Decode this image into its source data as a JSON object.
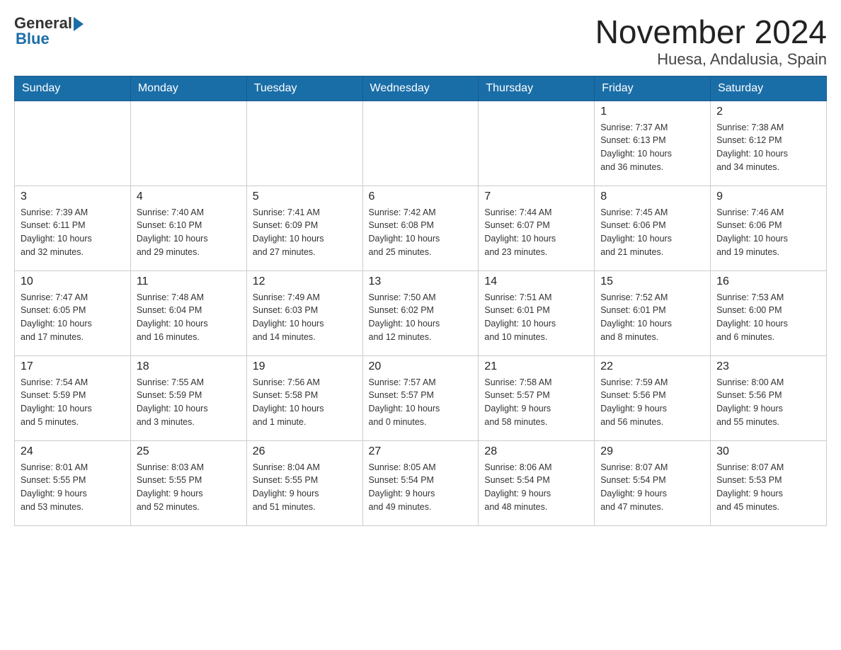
{
  "logo": {
    "general": "General",
    "blue": "Blue"
  },
  "title": "November 2024",
  "subtitle": "Huesa, Andalusia, Spain",
  "days_of_week": [
    "Sunday",
    "Monday",
    "Tuesday",
    "Wednesday",
    "Thursday",
    "Friday",
    "Saturday"
  ],
  "weeks": [
    [
      {
        "day": "",
        "info": ""
      },
      {
        "day": "",
        "info": ""
      },
      {
        "day": "",
        "info": ""
      },
      {
        "day": "",
        "info": ""
      },
      {
        "day": "",
        "info": ""
      },
      {
        "day": "1",
        "info": "Sunrise: 7:37 AM\nSunset: 6:13 PM\nDaylight: 10 hours\nand 36 minutes."
      },
      {
        "day": "2",
        "info": "Sunrise: 7:38 AM\nSunset: 6:12 PM\nDaylight: 10 hours\nand 34 minutes."
      }
    ],
    [
      {
        "day": "3",
        "info": "Sunrise: 7:39 AM\nSunset: 6:11 PM\nDaylight: 10 hours\nand 32 minutes."
      },
      {
        "day": "4",
        "info": "Sunrise: 7:40 AM\nSunset: 6:10 PM\nDaylight: 10 hours\nand 29 minutes."
      },
      {
        "day": "5",
        "info": "Sunrise: 7:41 AM\nSunset: 6:09 PM\nDaylight: 10 hours\nand 27 minutes."
      },
      {
        "day": "6",
        "info": "Sunrise: 7:42 AM\nSunset: 6:08 PM\nDaylight: 10 hours\nand 25 minutes."
      },
      {
        "day": "7",
        "info": "Sunrise: 7:44 AM\nSunset: 6:07 PM\nDaylight: 10 hours\nand 23 minutes."
      },
      {
        "day": "8",
        "info": "Sunrise: 7:45 AM\nSunset: 6:06 PM\nDaylight: 10 hours\nand 21 minutes."
      },
      {
        "day": "9",
        "info": "Sunrise: 7:46 AM\nSunset: 6:06 PM\nDaylight: 10 hours\nand 19 minutes."
      }
    ],
    [
      {
        "day": "10",
        "info": "Sunrise: 7:47 AM\nSunset: 6:05 PM\nDaylight: 10 hours\nand 17 minutes."
      },
      {
        "day": "11",
        "info": "Sunrise: 7:48 AM\nSunset: 6:04 PM\nDaylight: 10 hours\nand 16 minutes."
      },
      {
        "day": "12",
        "info": "Sunrise: 7:49 AM\nSunset: 6:03 PM\nDaylight: 10 hours\nand 14 minutes."
      },
      {
        "day": "13",
        "info": "Sunrise: 7:50 AM\nSunset: 6:02 PM\nDaylight: 10 hours\nand 12 minutes."
      },
      {
        "day": "14",
        "info": "Sunrise: 7:51 AM\nSunset: 6:01 PM\nDaylight: 10 hours\nand 10 minutes."
      },
      {
        "day": "15",
        "info": "Sunrise: 7:52 AM\nSunset: 6:01 PM\nDaylight: 10 hours\nand 8 minutes."
      },
      {
        "day": "16",
        "info": "Sunrise: 7:53 AM\nSunset: 6:00 PM\nDaylight: 10 hours\nand 6 minutes."
      }
    ],
    [
      {
        "day": "17",
        "info": "Sunrise: 7:54 AM\nSunset: 5:59 PM\nDaylight: 10 hours\nand 5 minutes."
      },
      {
        "day": "18",
        "info": "Sunrise: 7:55 AM\nSunset: 5:59 PM\nDaylight: 10 hours\nand 3 minutes."
      },
      {
        "day": "19",
        "info": "Sunrise: 7:56 AM\nSunset: 5:58 PM\nDaylight: 10 hours\nand 1 minute."
      },
      {
        "day": "20",
        "info": "Sunrise: 7:57 AM\nSunset: 5:57 PM\nDaylight: 10 hours\nand 0 minutes."
      },
      {
        "day": "21",
        "info": "Sunrise: 7:58 AM\nSunset: 5:57 PM\nDaylight: 9 hours\nand 58 minutes."
      },
      {
        "day": "22",
        "info": "Sunrise: 7:59 AM\nSunset: 5:56 PM\nDaylight: 9 hours\nand 56 minutes."
      },
      {
        "day": "23",
        "info": "Sunrise: 8:00 AM\nSunset: 5:56 PM\nDaylight: 9 hours\nand 55 minutes."
      }
    ],
    [
      {
        "day": "24",
        "info": "Sunrise: 8:01 AM\nSunset: 5:55 PM\nDaylight: 9 hours\nand 53 minutes."
      },
      {
        "day": "25",
        "info": "Sunrise: 8:03 AM\nSunset: 5:55 PM\nDaylight: 9 hours\nand 52 minutes."
      },
      {
        "day": "26",
        "info": "Sunrise: 8:04 AM\nSunset: 5:55 PM\nDaylight: 9 hours\nand 51 minutes."
      },
      {
        "day": "27",
        "info": "Sunrise: 8:05 AM\nSunset: 5:54 PM\nDaylight: 9 hours\nand 49 minutes."
      },
      {
        "day": "28",
        "info": "Sunrise: 8:06 AM\nSunset: 5:54 PM\nDaylight: 9 hours\nand 48 minutes."
      },
      {
        "day": "29",
        "info": "Sunrise: 8:07 AM\nSunset: 5:54 PM\nDaylight: 9 hours\nand 47 minutes."
      },
      {
        "day": "30",
        "info": "Sunrise: 8:07 AM\nSunset: 5:53 PM\nDaylight: 9 hours\nand 45 minutes."
      }
    ]
  ]
}
